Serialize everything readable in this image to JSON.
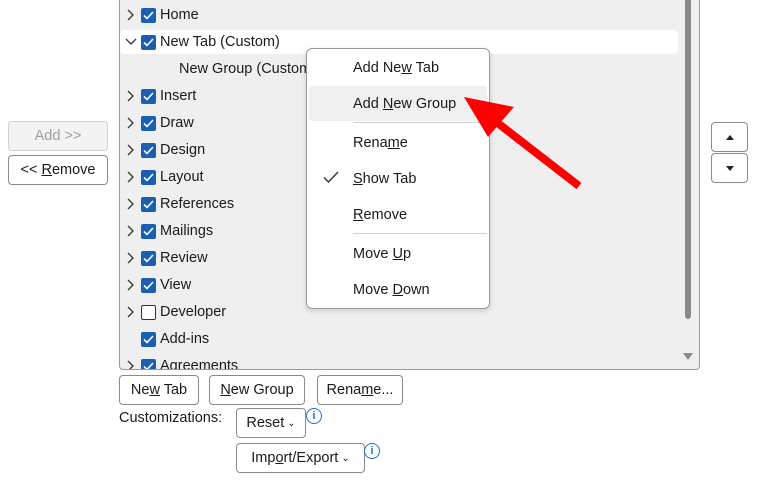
{
  "left_buttons": {
    "add": "Add >>",
    "remove": "<< Remove",
    "remove_mnemonic": 3
  },
  "tree": {
    "rows": [
      {
        "label": "Home",
        "checked": true,
        "expand": "collapsed"
      },
      {
        "label": "New Tab (Custom)",
        "checked": true,
        "expand": "expanded",
        "selected": true
      },
      {
        "label": "New Group (Custom)",
        "child": true
      },
      {
        "label": "Insert",
        "checked": true,
        "expand": "collapsed"
      },
      {
        "label": "Draw",
        "checked": true,
        "expand": "collapsed"
      },
      {
        "label": "Design",
        "checked": true,
        "expand": "collapsed"
      },
      {
        "label": "Layout",
        "checked": true,
        "expand": "collapsed"
      },
      {
        "label": "References",
        "checked": true,
        "expand": "collapsed"
      },
      {
        "label": "Mailings",
        "checked": true,
        "expand": "collapsed"
      },
      {
        "label": "Review",
        "checked": true,
        "expand": "collapsed"
      },
      {
        "label": "View",
        "checked": true,
        "expand": "collapsed"
      },
      {
        "label": "Developer",
        "checked": false,
        "expand": "collapsed"
      },
      {
        "label": "Add-ins",
        "checked": true,
        "expand": "none"
      },
      {
        "label": "Agreements",
        "checked": true,
        "expand": "collapsed"
      }
    ]
  },
  "context_menu": {
    "items": [
      {
        "label": "Add New Tab",
        "mn": 6
      },
      {
        "label": "Add New Group",
        "mn": 4,
        "hover": true
      },
      {
        "label": "Rename",
        "mn": 4,
        "sep_before": true
      },
      {
        "label": "Show Tab",
        "mn": 0,
        "checked": true
      },
      {
        "label": "Remove",
        "mn": 0
      },
      {
        "label": "Move Up",
        "mn": 5,
        "sep_before": true
      },
      {
        "label": "Move Down",
        "mn": 5
      }
    ]
  },
  "bottom": {
    "new_tab": "New Tab",
    "new_tab_mn": 2,
    "new_group": "New Group",
    "new_group_mn": 0,
    "rename": "Rename...",
    "rename_mn": 4,
    "customizations_label": "Customizations:",
    "reset": "Reset",
    "reset_mn": 1,
    "import_export": "Import/Export",
    "import_export_mn": 3,
    "info": "i"
  },
  "colors": {
    "accent": "#1a5fb4",
    "arrow": "#ff0000",
    "info": "#1a73c8"
  }
}
